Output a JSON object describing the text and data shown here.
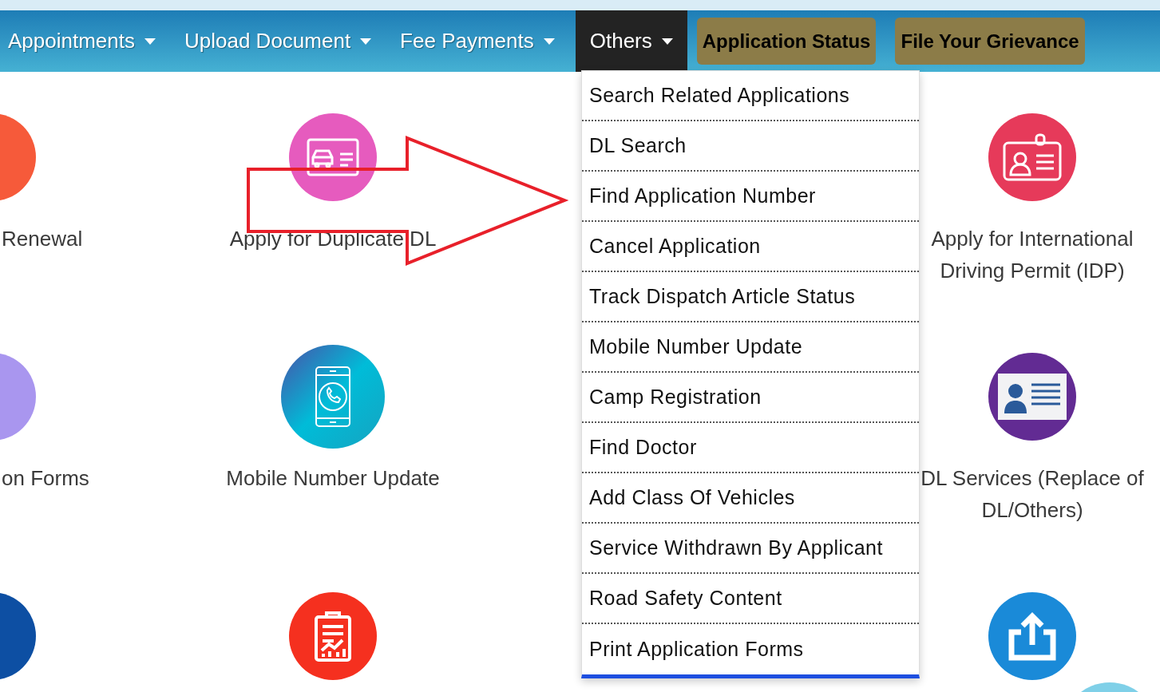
{
  "nav": {
    "items": [
      {
        "label": "Appointments",
        "selected": false
      },
      {
        "label": "Upload Document",
        "selected": false
      },
      {
        "label": "Fee Payments",
        "selected": false
      },
      {
        "label": "Others",
        "selected": true
      }
    ],
    "action_buttons": [
      "Application Status",
      "File Your Grievance"
    ]
  },
  "dropdown": {
    "items": [
      "Search Related Applications",
      "DL Search",
      "Find Application Number",
      "Cancel Application",
      "Track Dispatch Article Status",
      "Mobile Number Update",
      "Camp Registration",
      "Find Doctor",
      "Add Class Of Vehicles",
      "Service Withdrawn By Applicant",
      "Road Safety Content",
      "Print Application Forms"
    ]
  },
  "columns": [
    {
      "tiles": [
        {
          "kind": "plain",
          "color": "#f65a3a",
          "lines": [
            "Renewal"
          ]
        },
        {
          "kind": "plain",
          "color": "#a996ef",
          "lines": [
            "on Forms"
          ]
        },
        {
          "kind": "plain",
          "color": "#0d4fa3"
        }
      ]
    },
    {
      "tiles": [
        {
          "kind": "car-card",
          "color": "#e65bbe",
          "lines": [
            "Apply for Duplicate DL"
          ]
        },
        {
          "kind": "phone",
          "color": "#1eb3d6",
          "lines": [
            "Mobile Number Update"
          ]
        },
        {
          "kind": "clipboard",
          "color": "#f5301f"
        }
      ]
    },
    {
      "tiles": [
        {
          "kind": "badge",
          "color": "#e63a5a",
          "lines": [
            "Apply for International",
            "Driving Permit (IDP)"
          ]
        },
        {
          "kind": "id-card",
          "color": "#622b93",
          "lines": [
            "DL Services (Replace of",
            "DL/Others)"
          ]
        },
        {
          "kind": "upload",
          "color": "#1a8ad8"
        }
      ]
    }
  ]
}
